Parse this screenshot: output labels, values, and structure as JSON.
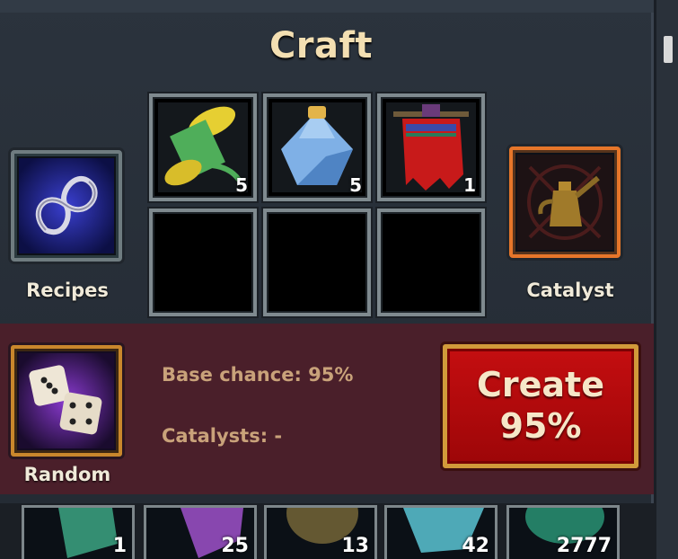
{
  "title": "Craft",
  "ingredients": [
    {
      "name": "spool-of-thread",
      "qty": "5"
    },
    {
      "name": "mana-flask",
      "qty": "5"
    },
    {
      "name": "red-banner",
      "qty": "1"
    },
    {
      "name": "empty",
      "qty": ""
    },
    {
      "name": "empty",
      "qty": ""
    },
    {
      "name": "empty",
      "qty": ""
    }
  ],
  "recipes": {
    "label": "Recipes",
    "icon": "infinity-rope-icon"
  },
  "catalyst": {
    "label": "Catalyst",
    "icon": "oil-can-icon"
  },
  "random": {
    "label": "Random",
    "icon": "dice-icon"
  },
  "stats": {
    "base_chance": "Base chance: 95%",
    "catalysts": "Catalysts: -"
  },
  "create": {
    "line1": "Create",
    "line2": "95%"
  },
  "inventory": [
    {
      "qty": "1",
      "color": "#3fae8a"
    },
    {
      "qty": "25",
      "color": "#a855d6"
    },
    {
      "qty": "13",
      "color": "#7a6a3a"
    },
    {
      "qty": "42",
      "color": "#5fd0e0"
    },
    {
      "qty": "2777",
      "color": "#2fae88"
    }
  ]
}
